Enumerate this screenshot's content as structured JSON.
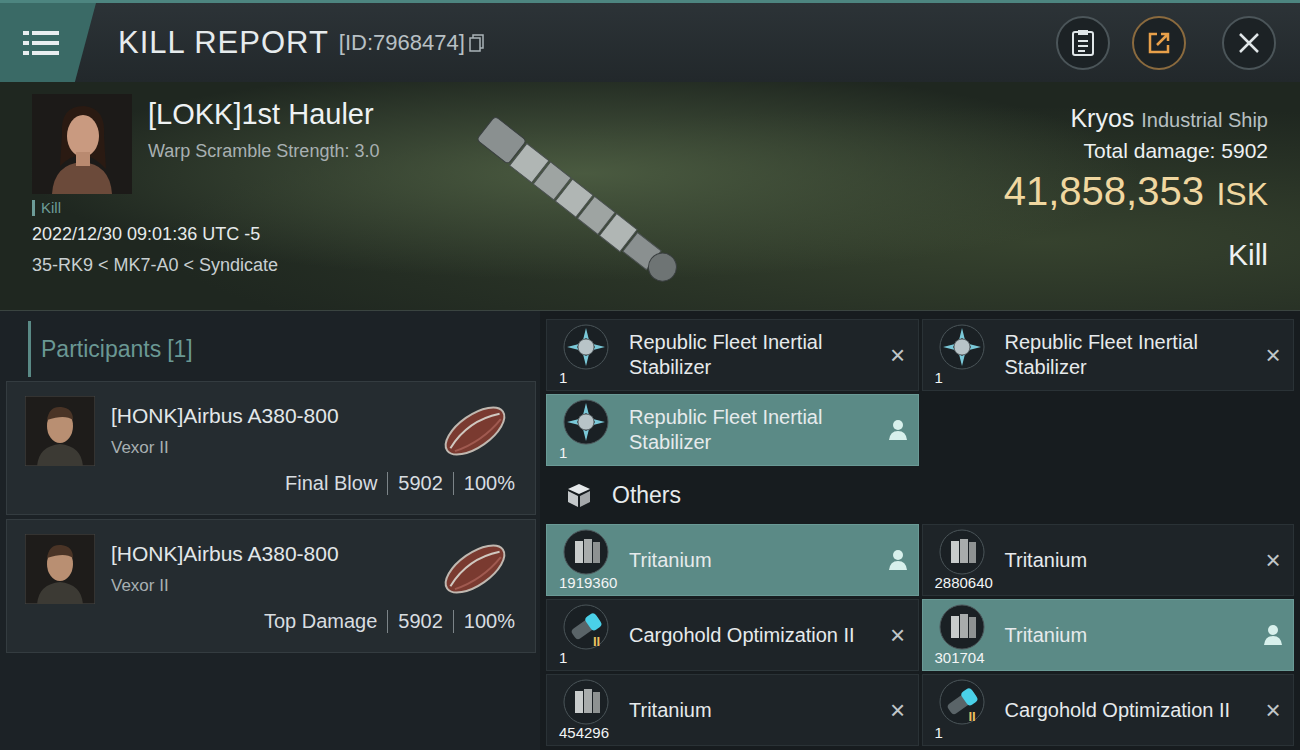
{
  "header": {
    "title": "KILL REPORT",
    "id": "[ID:7968474]"
  },
  "victim": {
    "name": "[LOKK]1st Hauler",
    "warp_scramble": "Warp Scramble Strength: 3.0",
    "tag": "Kill",
    "time": "2022/12/30 09:01:36 UTC -5",
    "location": "35-RK9 < MK7-A0 < Syndicate"
  },
  "ship": {
    "name": "Kryos",
    "class": "Industrial Ship",
    "damage_label": "Total damage:",
    "damage": "5902",
    "value": "41,858,353",
    "currency": "ISK",
    "result": "Kill"
  },
  "participants": {
    "title": "Participants",
    "count": "[1]",
    "items": [
      {
        "name": "[HONK]Airbus A380-800",
        "ship": "Vexor II",
        "role": "Final Blow",
        "damage": "5902",
        "share": "100%"
      },
      {
        "name": "[HONK]Airbus A380-800",
        "ship": "Vexor II",
        "role": "Top Damage",
        "damage": "5902",
        "share": "100%"
      }
    ]
  },
  "items": {
    "destroyed_mark": "×",
    "modules": [
      {
        "name": "Republic Fleet Inertial Stabilizer",
        "quantity": "1",
        "kind": "module",
        "dropped": false
      },
      {
        "name": "Republic Fleet Inertial Stabilizer",
        "quantity": "1",
        "kind": "module",
        "dropped": false
      },
      {
        "name": "Republic Fleet Inertial Stabilizer",
        "quantity": "1",
        "kind": "module",
        "dropped": true
      }
    ],
    "others": {
      "title": "Others",
      "entries": [
        {
          "name": "Tritanium",
          "quantity": "1919360",
          "kind": "mineral",
          "dropped": true
        },
        {
          "name": "Tritanium",
          "quantity": "2880640",
          "kind": "mineral",
          "dropped": false
        },
        {
          "name": "Cargohold Optimization II",
          "quantity": "1",
          "kind": "rig",
          "badge": "II",
          "dropped": false
        },
        {
          "name": "Tritanium",
          "quantity": "301704",
          "kind": "mineral",
          "dropped": true
        },
        {
          "name": "Tritanium",
          "quantity": "454296",
          "kind": "mineral",
          "dropped": false
        },
        {
          "name": "Cargohold Optimization II",
          "quantity": "1",
          "kind": "rig",
          "badge": "II",
          "dropped": false
        }
      ]
    }
  }
}
